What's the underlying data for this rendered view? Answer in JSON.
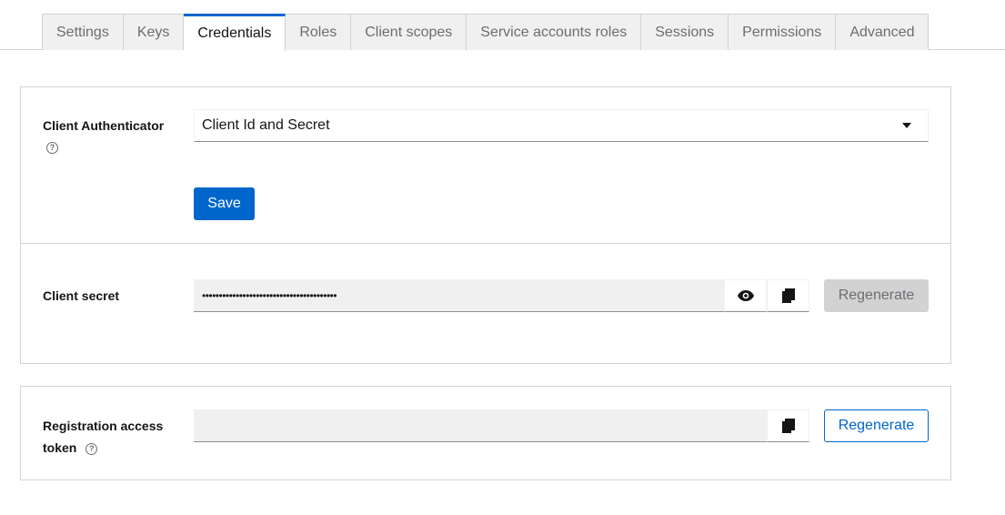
{
  "tabs": [
    {
      "label": "Settings",
      "active": false
    },
    {
      "label": "Keys",
      "active": false
    },
    {
      "label": "Credentials",
      "active": true
    },
    {
      "label": "Roles",
      "active": false
    },
    {
      "label": "Client scopes",
      "active": false
    },
    {
      "label": "Service accounts roles",
      "active": false
    },
    {
      "label": "Sessions",
      "active": false
    },
    {
      "label": "Permissions",
      "active": false
    },
    {
      "label": "Advanced",
      "active": false
    }
  ],
  "authenticator": {
    "label": "Client Authenticator",
    "help_icon": "help-circle-icon",
    "selected": "Client Id and Secret",
    "save_label": "Save"
  },
  "secret": {
    "label": "Client secret",
    "masked_value": "••••••••••••••••••••••••••••••••••••••••",
    "show_icon": "eye-icon",
    "copy_icon": "copy-icon",
    "regenerate_label": "Regenerate"
  },
  "registration": {
    "label_line1": "Registration access",
    "label_line2": "token",
    "help_icon": "help-circle-icon",
    "value": "",
    "copy_icon": "copy-icon",
    "regenerate_label": "Regenerate"
  },
  "colors": {
    "accent": "#0066cc",
    "border": "#d2d2d2",
    "field_bg": "#f0f0f0"
  }
}
